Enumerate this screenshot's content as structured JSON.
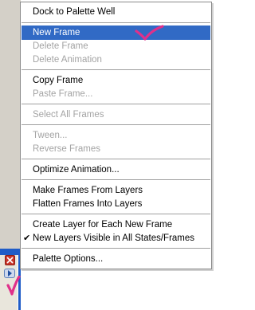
{
  "colors": {
    "menu_bg": "#ffffff",
    "selection": "#316ac5",
    "disabled_text": "#a3a3a3",
    "separator": "#a0a0a0",
    "palette_blue": "#1f5cc7",
    "palette_gray": "#d4d0c8",
    "close_red": "#c8362b",
    "annotation_pink": "#e0308a"
  },
  "menu": {
    "items": [
      {
        "label": "Dock to Palette Well",
        "enabled": true
      },
      {
        "label": "New Frame",
        "enabled": true,
        "highlighted": true
      },
      {
        "label": "Delete Frame",
        "enabled": false
      },
      {
        "label": "Delete Animation",
        "enabled": false
      },
      {
        "label": "Copy Frame",
        "enabled": true
      },
      {
        "label": "Paste Frame...",
        "enabled": false
      },
      {
        "label": "Select All Frames",
        "enabled": false
      },
      {
        "label": "Tween...",
        "enabled": false
      },
      {
        "label": "Reverse Frames",
        "enabled": false
      },
      {
        "label": "Optimize Animation...",
        "enabled": true
      },
      {
        "label": "Make Frames From Layers",
        "enabled": true
      },
      {
        "label": "Flatten Frames Into Layers",
        "enabled": true
      },
      {
        "label": "Create Layer for Each New Frame",
        "enabled": true
      },
      {
        "label": "New Layers Visible in All States/Frames",
        "enabled": true,
        "checked": true
      },
      {
        "label": "Palette Options...",
        "enabled": true
      }
    ]
  },
  "icons": {
    "close": "close-icon",
    "palette_arrow": "triangle-right-icon",
    "checkmark": "checkmark-icon",
    "annotation": "pink-checkmark-icon"
  }
}
